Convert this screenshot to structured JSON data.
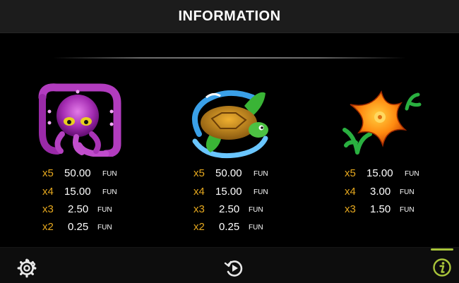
{
  "header": {
    "title": "INFORMATION"
  },
  "currency": "FUN",
  "symbols": [
    {
      "name": "octopus",
      "payouts": [
        {
          "mult": "x5",
          "value": "50.00"
        },
        {
          "mult": "x4",
          "value": "15.00"
        },
        {
          "mult": "x3",
          "value": "2.50"
        },
        {
          "mult": "x2",
          "value": "0.25"
        }
      ]
    },
    {
      "name": "turtle",
      "payouts": [
        {
          "mult": "x5",
          "value": "50.00"
        },
        {
          "mult": "x4",
          "value": "15.00"
        },
        {
          "mult": "x3",
          "value": "2.50"
        },
        {
          "mult": "x2",
          "value": "0.25"
        }
      ]
    },
    {
      "name": "starfish",
      "payouts": [
        {
          "mult": "x5",
          "value": "15.00"
        },
        {
          "mult": "x4",
          "value": "3.00"
        },
        {
          "mult": "x3",
          "value": "1.50"
        }
      ]
    }
  ],
  "footer": {
    "settings_icon": "gear-icon",
    "replay_icon": "replay-icon",
    "info_icon": "info-icon"
  },
  "colors": {
    "multiplier": "#e6a81e",
    "accent": "#a8c43a",
    "header_bg": "#1c1c1c"
  }
}
